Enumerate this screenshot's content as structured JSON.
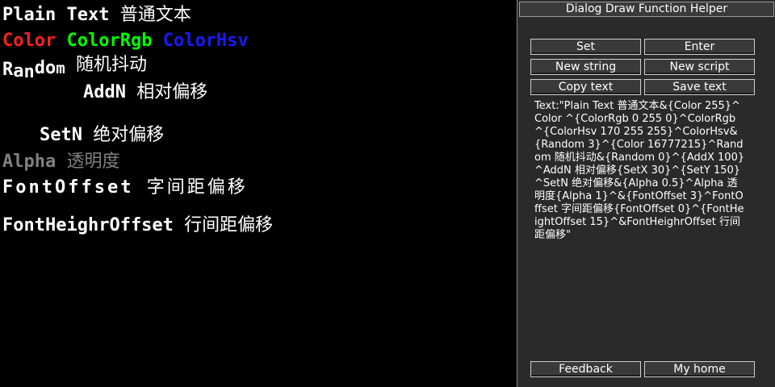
{
  "canvas": {
    "plain_text": "Plain Text",
    "plain_text_cn": "普通文本",
    "color_label": "Color",
    "colorrgb_label": "ColorRgb",
    "colorhsv_label": "ColorHsv",
    "random_chars": [
      "R",
      "a",
      "n",
      "d",
      "o",
      "m"
    ],
    "random_cn": "随机抖动",
    "addn_label": "AddN",
    "addn_cn": "相对偏移",
    "setn_label": "SetN",
    "setn_cn": "绝对偏移",
    "alpha_label": "Alpha",
    "alpha_cn": "透明度",
    "fontoffset_label": "FontOffset",
    "fontoffset_cn": "字间距偏移",
    "fontheight_label": "FontHeighrOffset",
    "fontheight_cn": "行间距偏移"
  },
  "colors": {
    "color_red": "#ff2020",
    "colorrgb_green": "#00ff00",
    "colorhsv_blue": "#1a1aff",
    "alpha_gray": "#808080"
  },
  "panel": {
    "title": "Dialog Draw Function Helper",
    "buttons": {
      "set": "Set",
      "enter": "Enter",
      "new_string": "New string",
      "new_script": "New script",
      "copy_text": "Copy text",
      "save_text": "Save text",
      "feedback": "Feedback",
      "my_home": "My home"
    },
    "output_text": "Text:\"Plain Text 普通文本&{Color 255}^Color ^{ColorRgb 0 255 0}^ColorRgb ^{ColorHsv 170 255 255}^ColorHsv&{Random 3}^{Color 16777215}^Random 随机抖动&{Random 0}^{AddX 100}^AddN 相对偏移{SetX 30}^{SetY 150}^SetN 绝对偏移&{Alpha 0.5}^Alpha 透明度{Alpha 1}^&{FontOffset 3}^FontOffset 字间距偏移{FontOffset 0}^{FontHeightOffset 15}^&FontHeighrOffset 行间距偏移\""
  }
}
